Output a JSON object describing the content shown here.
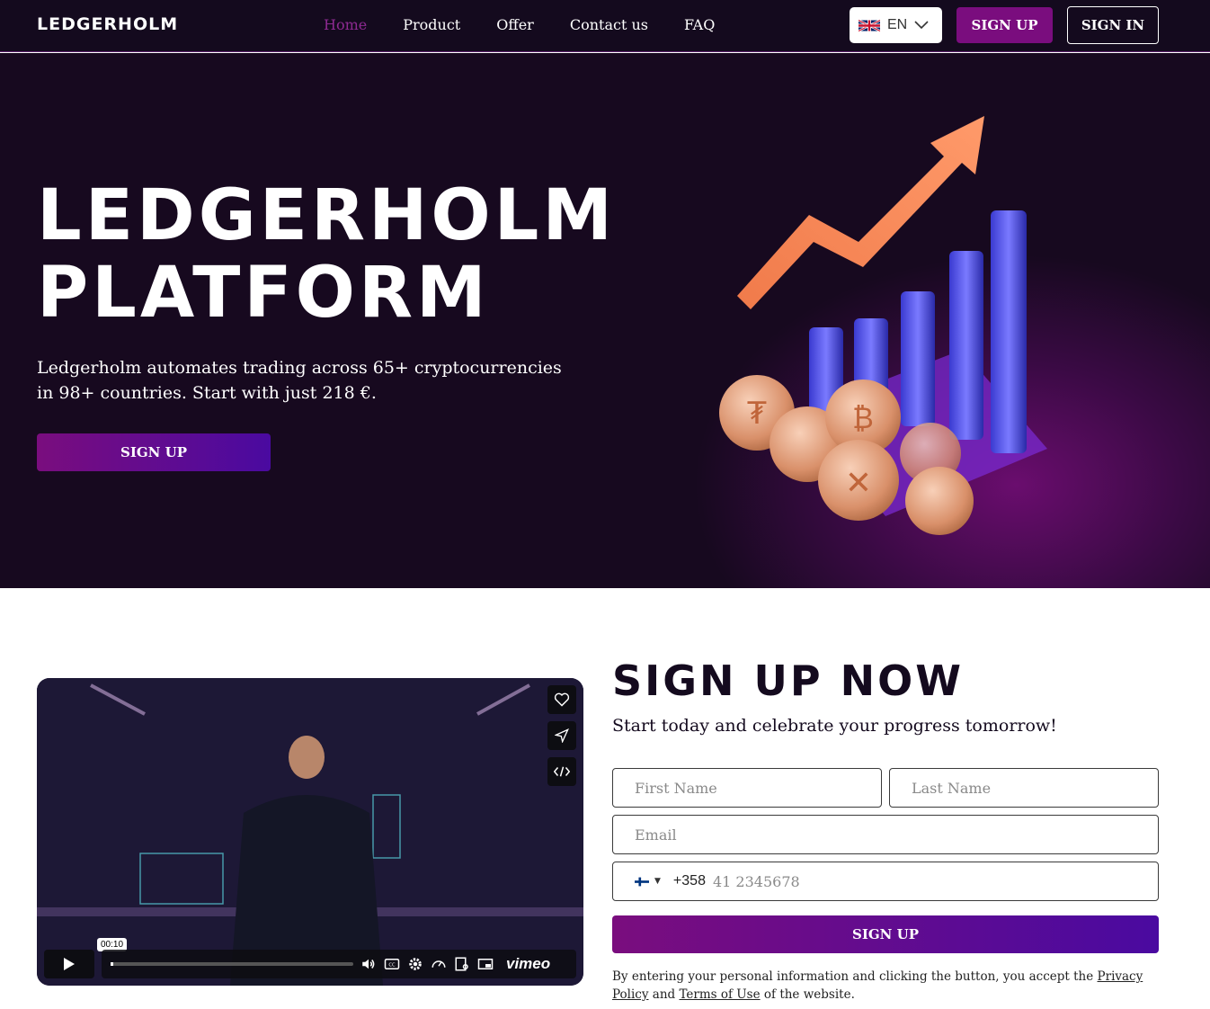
{
  "header": {
    "logo": "LEDGERHOLM",
    "nav": [
      "Home",
      "Product",
      "Offer",
      "Contact us",
      "FAQ"
    ],
    "active_nav": "Home",
    "language": "EN",
    "signup_label": "SIGN UP",
    "signin_label": "SIGN IN"
  },
  "hero": {
    "title_line1": "LEDGERHOLM",
    "title_line2": "PLATFORM",
    "subtitle": "Ledgerholm automates trading across 65+ cryptocurrencies in 98+ countries. Start with just 218 €.",
    "cta_label": "SIGN UP"
  },
  "video": {
    "timestamp": "00:10",
    "brand": "vimeo",
    "progress": 0.01
  },
  "signup": {
    "title": "SIGN UP NOW",
    "subtitle": "Start today and celebrate your progress tomorrow!",
    "first_name_placeholder": "First Name",
    "last_name_placeholder": "Last Name",
    "email_placeholder": "Email",
    "dial_code": "+358",
    "phone_placeholder": "41 2345678",
    "submit_label": "SIGN UP",
    "legal_prefix": "By entering your personal information and clicking the button, you accept the ",
    "privacy_link": "Privacy Policy",
    "legal_and": " and ",
    "terms_link": "Terms of Use",
    "legal_suffix": " of the website."
  },
  "colors": {
    "brand_purple": "#7a0d7e",
    "header_bg": "#140a1e",
    "active_nav": "#8e2a92"
  }
}
